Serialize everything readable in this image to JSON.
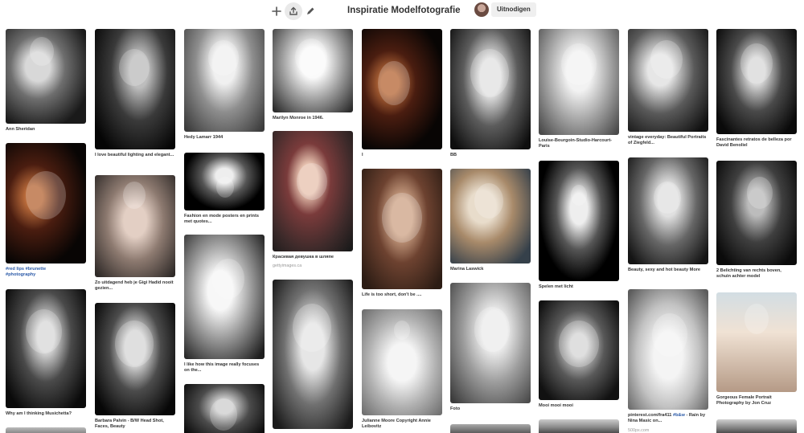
{
  "toolbar": {
    "title": "Inspiratie Modelfotografie",
    "invite_label": "Uitnodigen",
    "icons": [
      "plus-icon",
      "share-icon",
      "pencil-icon"
    ]
  },
  "pins": [
    {
      "caption": "Ann Sheridan"
    },
    {
      "caption": "",
      "tags": [
        "#red lips",
        "#brunette",
        "#photography"
      ]
    },
    {
      "caption": "Why am I thinking Musichetta?"
    },
    {
      "caption": "I love beautiful lighting and elegant..."
    },
    {
      "caption": "Zo uitdagend heb je Gigi Hadid nooit gezien..."
    },
    {
      "caption": "Barbara Palvin - B/W Head Shot, Faces, Beauty"
    },
    {
      "caption": "Hedy Lamarr 1944"
    },
    {
      "caption": "Fashion en mode posters en prints met quotes..."
    },
    {
      "caption": "I like how this image really focuses on the..."
    },
    {
      "caption": "Marilyn Monroe in 1946."
    },
    {
      "caption": "Красивая девушка в шляпе",
      "source": "gettyimages.ca"
    },
    {
      "caption": "I"
    },
    {
      "caption": "Life is too short, don't be ...."
    },
    {
      "caption": "Julianne Moore Copyright Annie Leibovitz"
    },
    {
      "caption": "BB"
    },
    {
      "caption": "Marina Laswick"
    },
    {
      "caption": "Foto"
    },
    {
      "caption": "Louise-Bourgoin-Studio-Harcourt-Paris"
    },
    {
      "caption": "Spelen met licht"
    },
    {
      "caption": "Mooi mooi mooi"
    },
    {
      "caption": "vintage everyday: Beautiful Portraits of Ziegfeld..."
    },
    {
      "caption": "Beauty, sexy and hot beauty More"
    },
    {
      "caption": "pinterest.com/fra411 ",
      "tags": [
        "#b&w"
      ],
      "caption_after": " - Rain by Nina Masic on...",
      "source": "500px.com"
    },
    {
      "caption": "Fascinantes retratos de belleza por David Benoliel"
    },
    {
      "caption": "2 Belichting van rechts boven, schuin achter model"
    },
    {
      "caption": "Gorgeous Female Portrait Photography by Jon Cruz"
    }
  ]
}
